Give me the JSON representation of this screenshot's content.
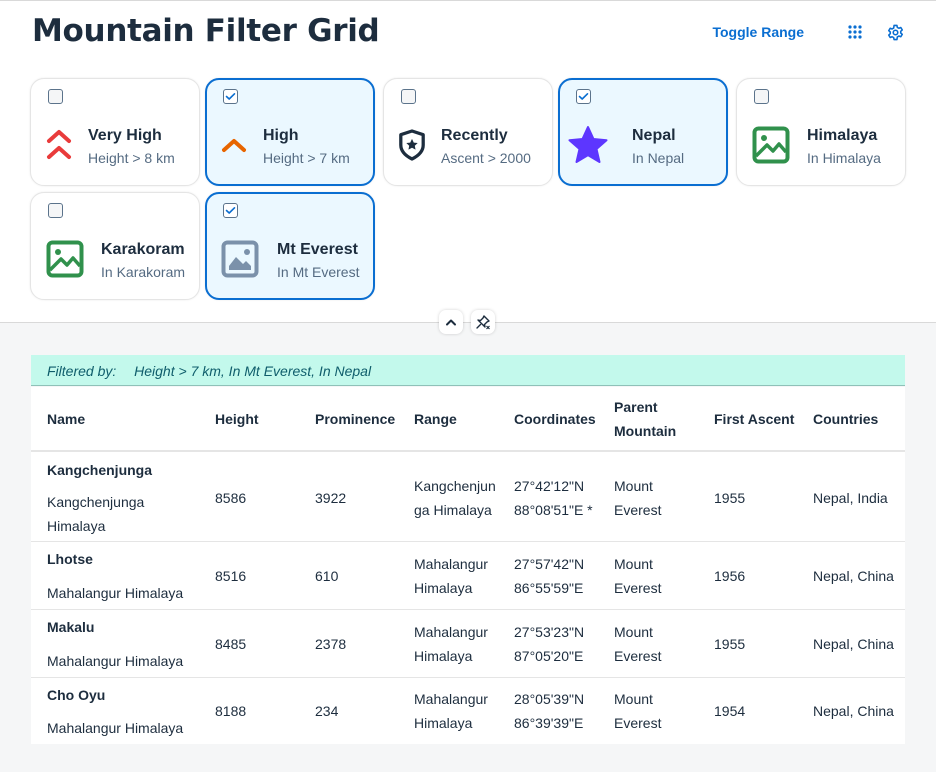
{
  "header": {
    "title": "Mountain Filter Grid",
    "toggle_range_label": "Toggle Range",
    "apps_icon": "grid-icon",
    "settings_icon": "gear-icon"
  },
  "tiles": [
    {
      "title": "Very High",
      "subtitle": "Height > 8 km",
      "icon": "double-chevron-up-icon",
      "checked": false
    },
    {
      "title": "High",
      "subtitle": "Height > 7 km",
      "icon": "chevron-up-icon",
      "checked": true
    },
    {
      "title": "Recently",
      "subtitle": "Ascent > 2000",
      "icon": "shield-star-icon",
      "checked": false
    },
    {
      "title": "Nepal",
      "subtitle": "In Nepal",
      "icon": "star-icon",
      "checked": true
    },
    {
      "title": "Himalaya",
      "subtitle": "In Himalaya",
      "icon": "image-icon",
      "checked": false
    },
    {
      "title": "Karakoram",
      "subtitle": "In Karakoram",
      "icon": "image-icon",
      "checked": false
    },
    {
      "title": "Mt Everest",
      "subtitle": "In Mt Everest",
      "icon": "image-placeholder-icon",
      "checked": true
    }
  ],
  "colors": {
    "accent": "#0a6ed1",
    "very_high": "#e93b3b",
    "high": "#e76500",
    "nepal_star": "#5d36ff",
    "image_green": "#30914c",
    "image_grey": "#7b91aa",
    "filter_bar_bg": "#c3f9ec"
  },
  "filter": {
    "label": "Filtered by:",
    "value": "Height > 7 km, In Mt Everest, In Nepal"
  },
  "table": {
    "columns": [
      "Name",
      "Height",
      "Prominence",
      "Range",
      "Coordinates",
      "Parent Mountain",
      "First Ascent",
      "Countries"
    ],
    "column_lines": {
      "parent_line1": "Parent",
      "parent_line2": "Mountain"
    },
    "rows": [
      {
        "name": "Kangchenjunga",
        "range_sub": "Kangchenjunga Himalaya",
        "height": "8586",
        "prominence": "3922",
        "range": "Kangchenjunga Himalaya",
        "lat": "27°42'12\"N",
        "lon": "88°08'51\"E *",
        "parent": "Mount Everest",
        "first_ascent": "1955",
        "countries": "Nepal, India"
      },
      {
        "name": "Lhotse",
        "range_sub": "Mahalangur Himalaya",
        "height": "8516",
        "prominence": "610",
        "range": "Mahalangur Himalaya",
        "lat": "27°57'42\"N",
        "lon": "86°55'59\"E",
        "parent": "Mount Everest",
        "first_ascent": "1956",
        "countries": "Nepal, China"
      },
      {
        "name": "Makalu",
        "range_sub": "Mahalangur Himalaya",
        "height": "8485",
        "prominence": "2378",
        "range": "Mahalangur Himalaya",
        "lat": "27°53'23\"N",
        "lon": "87°05'20\"E",
        "parent": "Mount Everest",
        "first_ascent": "1955",
        "countries": "Nepal, China"
      },
      {
        "name": "Cho Oyu",
        "range_sub": "Mahalangur Himalaya",
        "height": "8188",
        "prominence": "234",
        "range": "Mahalangur Himalaya",
        "lat": "28°05'39\"N",
        "lon": "86°39'39\"E",
        "parent": "Mount Everest",
        "first_ascent": "1954",
        "countries": "Nepal, China"
      }
    ]
  }
}
